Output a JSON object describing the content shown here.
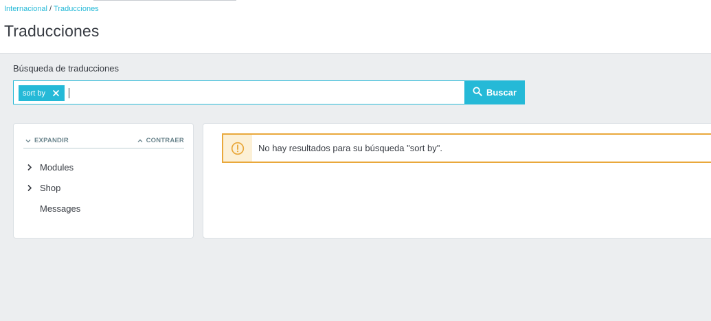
{
  "breadcrumb": {
    "parent": "Internacional",
    "separator": "/",
    "current": "Traducciones"
  },
  "page": {
    "title": "Traducciones"
  },
  "search": {
    "label": "Búsqueda de traducciones",
    "tag": "sort by",
    "button_label": "Buscar",
    "input_value": ""
  },
  "tree": {
    "expand_label": "EXPANDIR",
    "collapse_label": "CONTRAER",
    "items": [
      {
        "label": "Modules",
        "has_children": true
      },
      {
        "label": "Shop",
        "has_children": true
      },
      {
        "label": "Messages",
        "has_children": false
      }
    ]
  },
  "alert": {
    "type": "warning",
    "message": "No hay resultados para su búsqueda \"sort by\"."
  },
  "colors": {
    "accent": "#25b9d7",
    "warning": "#e9a83b",
    "warning_bg": "#fcf0d6"
  },
  "icons": {
    "search": "search-icon",
    "tag_close": "close-icon",
    "warning": "warning-icon"
  }
}
